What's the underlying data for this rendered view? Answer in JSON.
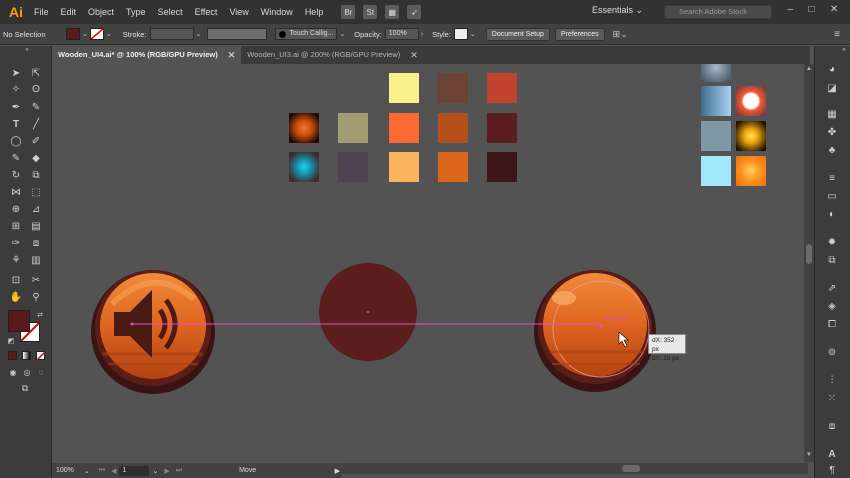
{
  "menubar": {
    "logo": "Ai",
    "items": [
      "File",
      "Edit",
      "Object",
      "Type",
      "Select",
      "Effect",
      "View",
      "Window",
      "Help"
    ],
    "workspace": "Essentials",
    "search_placeholder": "Search Adobe Stock"
  },
  "controlbar": {
    "selection": "No Selection",
    "fill_color": "#5a1a1a",
    "stroke_label": "Stroke:",
    "brush": "Touch Callig...",
    "opacity_label": "Opacity:",
    "opacity": "100%",
    "style_label": "Style:",
    "doc_setup": "Document Setup",
    "preferences": "Preferences"
  },
  "tabs": [
    {
      "label": "Wooden_UI4.ai* @ 100% (RGB/GPU Preview)",
      "active": true
    },
    {
      "label": "Wooden_UI3.ai @ 200% (RGB/GPU Preview)",
      "active": false
    }
  ],
  "canvas": {
    "swatch_colors_row1": [
      "#f9f28a",
      "#6b4234",
      "#c0432e"
    ],
    "swatch_colors_row2": [
      "#e06a14",
      "#a39b72",
      "#fa6a33",
      "#b54f1c",
      "#5b1d1d"
    ],
    "swatch_colors_row3": [
      "#1aa7c4",
      "#4c4250",
      "#fbb35e",
      "#d9661a",
      "#3d1619"
    ],
    "right_swatches": [
      "#7da8c6",
      "#f15a33",
      "#7f99a4",
      "#f4a90c",
      "#a3e7fa",
      "#ff8f1b"
    ],
    "circle_color": "#5a1e1e",
    "smart_guide_label": "intersect",
    "tooltip_dx": "dX: 352 px",
    "tooltip_dy": "dY: 19 px"
  },
  "status": {
    "zoom": "100%",
    "artboard": "1",
    "tool_status": "Move"
  }
}
